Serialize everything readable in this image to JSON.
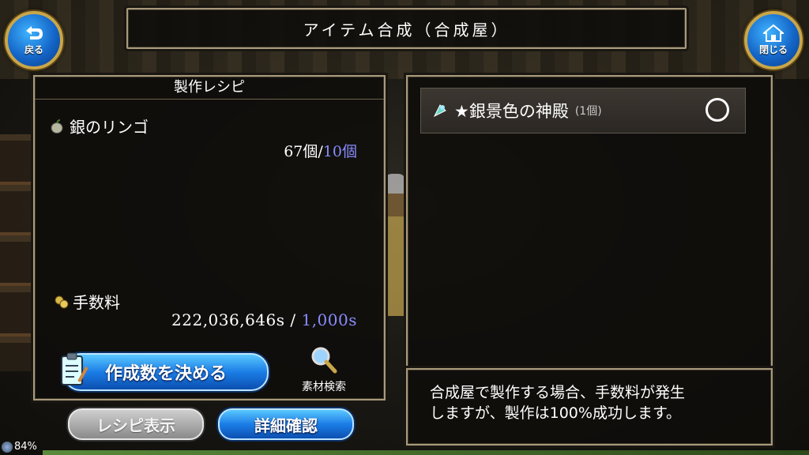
{
  "header": {
    "title": "アイテム合成（合成屋）",
    "back_label": "戻る",
    "close_label": "閉じる"
  },
  "recipe_panel": {
    "heading": "製作レシピ",
    "material": {
      "name": "銀のリンゴ",
      "icon": "silver-apple-icon",
      "have": "67個",
      "separator": "/",
      "need": "10個"
    },
    "fee": {
      "label": "手数料",
      "icon": "coins-icon",
      "have": "222,036,646s",
      "separator": " / ",
      "need": "1,000s"
    },
    "craft_button": "作成数を決める",
    "search_caption": "素材検索"
  },
  "bottom_buttons": {
    "recipe_view": "レシピ表示",
    "detail_check": "詳細確認"
  },
  "result_panel": {
    "item_name": "★銀景色の神殿",
    "item_qty": "(1個)",
    "item_icon": "crystal-item-icon",
    "status_mark": "○"
  },
  "description": {
    "text": "合成屋で製作する場合、手数料が発生\nしますが、製作は100%成功します。"
  },
  "status": {
    "battery": "84%"
  },
  "colors": {
    "accent_blue": "#1b7de6",
    "need_value": "#8a8cff",
    "frame": "#a89a7c"
  }
}
